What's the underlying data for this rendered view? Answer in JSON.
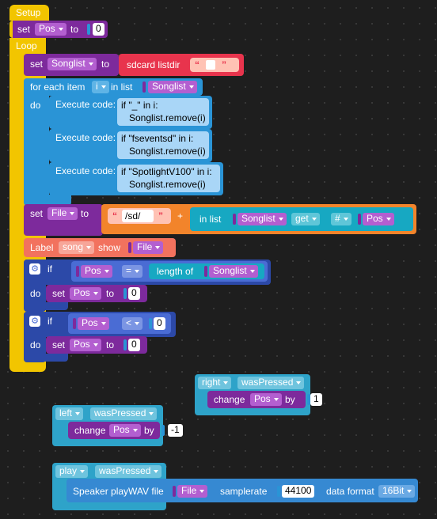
{
  "setup_label": "Setup",
  "loop_label": "Loop",
  "kw": {
    "set": "set",
    "to": "to",
    "for_each_item": "for each item",
    "in_list": "in list",
    "do": "do",
    "execute_code": "Execute code:",
    "if": "if",
    "change": "change",
    "by": "by",
    "show": "show",
    "label": "Label",
    "length_of": "length of",
    "get": "get",
    "hash": "#",
    "plus": "+",
    "samplerate": "samplerate",
    "data_format": "data format",
    "speaker_play": "Speaker playWAV file",
    "sdcard_listdir": "sdcard listdir",
    "was_pressed": "wasPressed"
  },
  "vars": {
    "pos": "Pos",
    "songlist": "Songlist",
    "item": "i",
    "file": "File"
  },
  "code": {
    "c1_line1": "if \"_\" in i:",
    "c1_line2": "Songlist.remove(i)",
    "c2_line1": "if \"fseventsd\" in i:",
    "c2_line2": "Songlist.remove(i)",
    "c3_line1": "if \"SpotlightV100\" in i:",
    "c3_line2": "Songlist.remove(i)"
  },
  "strings": {
    "sd_prefix": "/sd/",
    "quote_open": "“",
    "quote_close": "”",
    "empty_str": ""
  },
  "values": {
    "zero": "0",
    "one": "1",
    "minus_one": "-1",
    "samplerate": "44100"
  },
  "ops": {
    "eq": "=",
    "lt": "<"
  },
  "labels": {
    "song": "song"
  },
  "buttons": {
    "right": "right",
    "left": "left",
    "play": "play"
  },
  "formats": {
    "bits": "16Bit"
  },
  "colors": {
    "setup": "#f2c500",
    "variable": "#7d2a9c",
    "control": "#2a94d6",
    "code": "#64b5f0",
    "logic": "#2c49a8",
    "string": "#ff7a52",
    "list": "#17a8c2",
    "label": "#f2725e",
    "button": "#2ea3c9",
    "speaker": "#3689d2",
    "var_pill": "#b35fd0"
  }
}
